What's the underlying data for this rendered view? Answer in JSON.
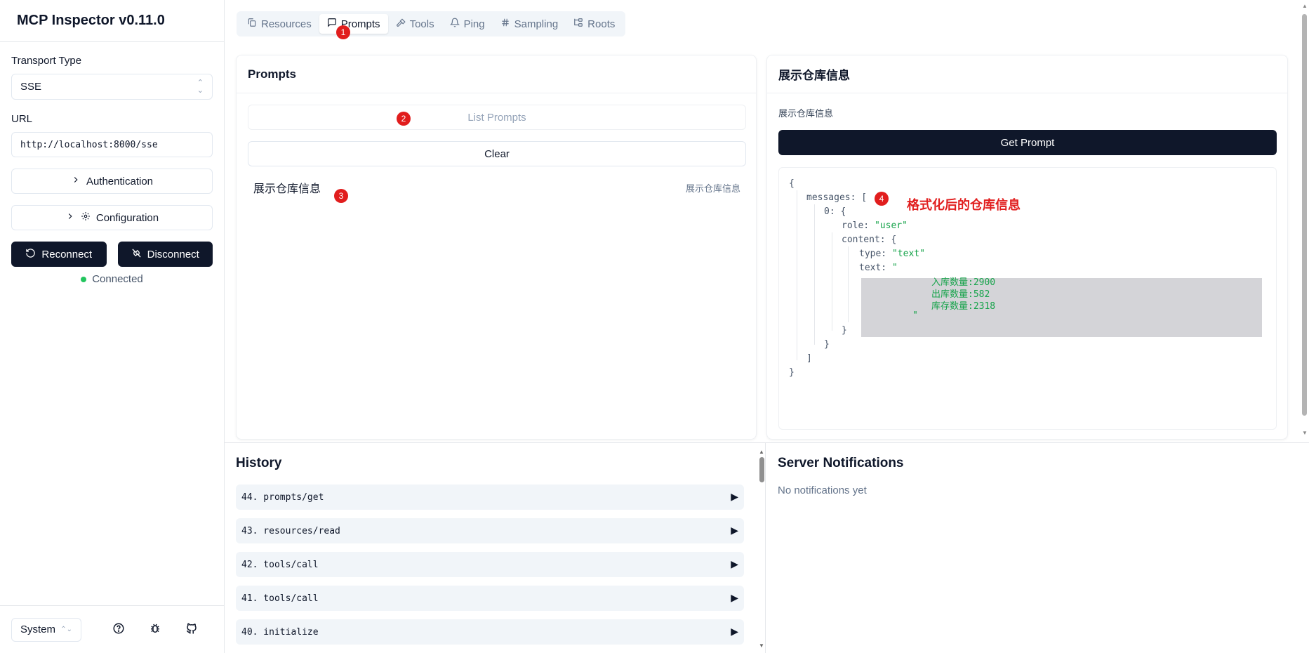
{
  "app": {
    "title": "MCP Inspector v0.11.0"
  },
  "sidebar": {
    "transport_label": "Transport Type",
    "transport_value": "SSE",
    "url_label": "URL",
    "url_value": "http://localhost:8000/sse",
    "auth_label": "Authentication",
    "config_label": "Configuration",
    "reconnect_label": "Reconnect",
    "disconnect_label": "Disconnect",
    "status_text": "Connected",
    "status_color": "#22c55e",
    "theme_value": "System"
  },
  "tabs": [
    {
      "label": "Resources",
      "icon": "files-icon"
    },
    {
      "label": "Prompts",
      "icon": "message-square-icon",
      "active": true
    },
    {
      "label": "Tools",
      "icon": "hammer-icon"
    },
    {
      "label": "Ping",
      "icon": "bell-icon"
    },
    {
      "label": "Sampling",
      "icon": "hash-icon"
    },
    {
      "label": "Roots",
      "icon": "folder-tree-icon"
    }
  ],
  "prompts_panel": {
    "title": "Prompts",
    "list_button": "List Prompts",
    "clear_button": "Clear",
    "items": [
      {
        "name": "展示仓库信息",
        "description": "展示仓库信息"
      }
    ]
  },
  "detail_panel": {
    "title": "展示仓库信息",
    "description": "展示仓库信息",
    "get_button": "Get Prompt",
    "json": {
      "open_brace": "{",
      "messages_key": "messages:",
      "open_bracket": "[",
      "index_key": "0:",
      "role_key": "role:",
      "role_value": "\"user\"",
      "content_key": "content:",
      "type_key": "type:",
      "type_value": "\"text\"",
      "text_key": "text:",
      "text_open": "\"",
      "text_line1": "入库数量:2900",
      "text_line2": "出库数量:582",
      "text_line3": "库存数量:2318",
      "text_close": "\"",
      "close_brace": "}",
      "close_bracket": "]"
    }
  },
  "annotation": {
    "text": "格式化后的仓库信息",
    "badges": [
      "1",
      "2",
      "3",
      "4"
    ],
    "color": "#e11d1d"
  },
  "history": {
    "title": "History",
    "rows": [
      {
        "label": "44. prompts/get"
      },
      {
        "label": "43. resources/read"
      },
      {
        "label": "42. tools/call"
      },
      {
        "label": "41. tools/call"
      },
      {
        "label": "40. initialize"
      }
    ]
  },
  "notifications": {
    "title": "Server Notifications",
    "empty_text": "No notifications yet"
  }
}
